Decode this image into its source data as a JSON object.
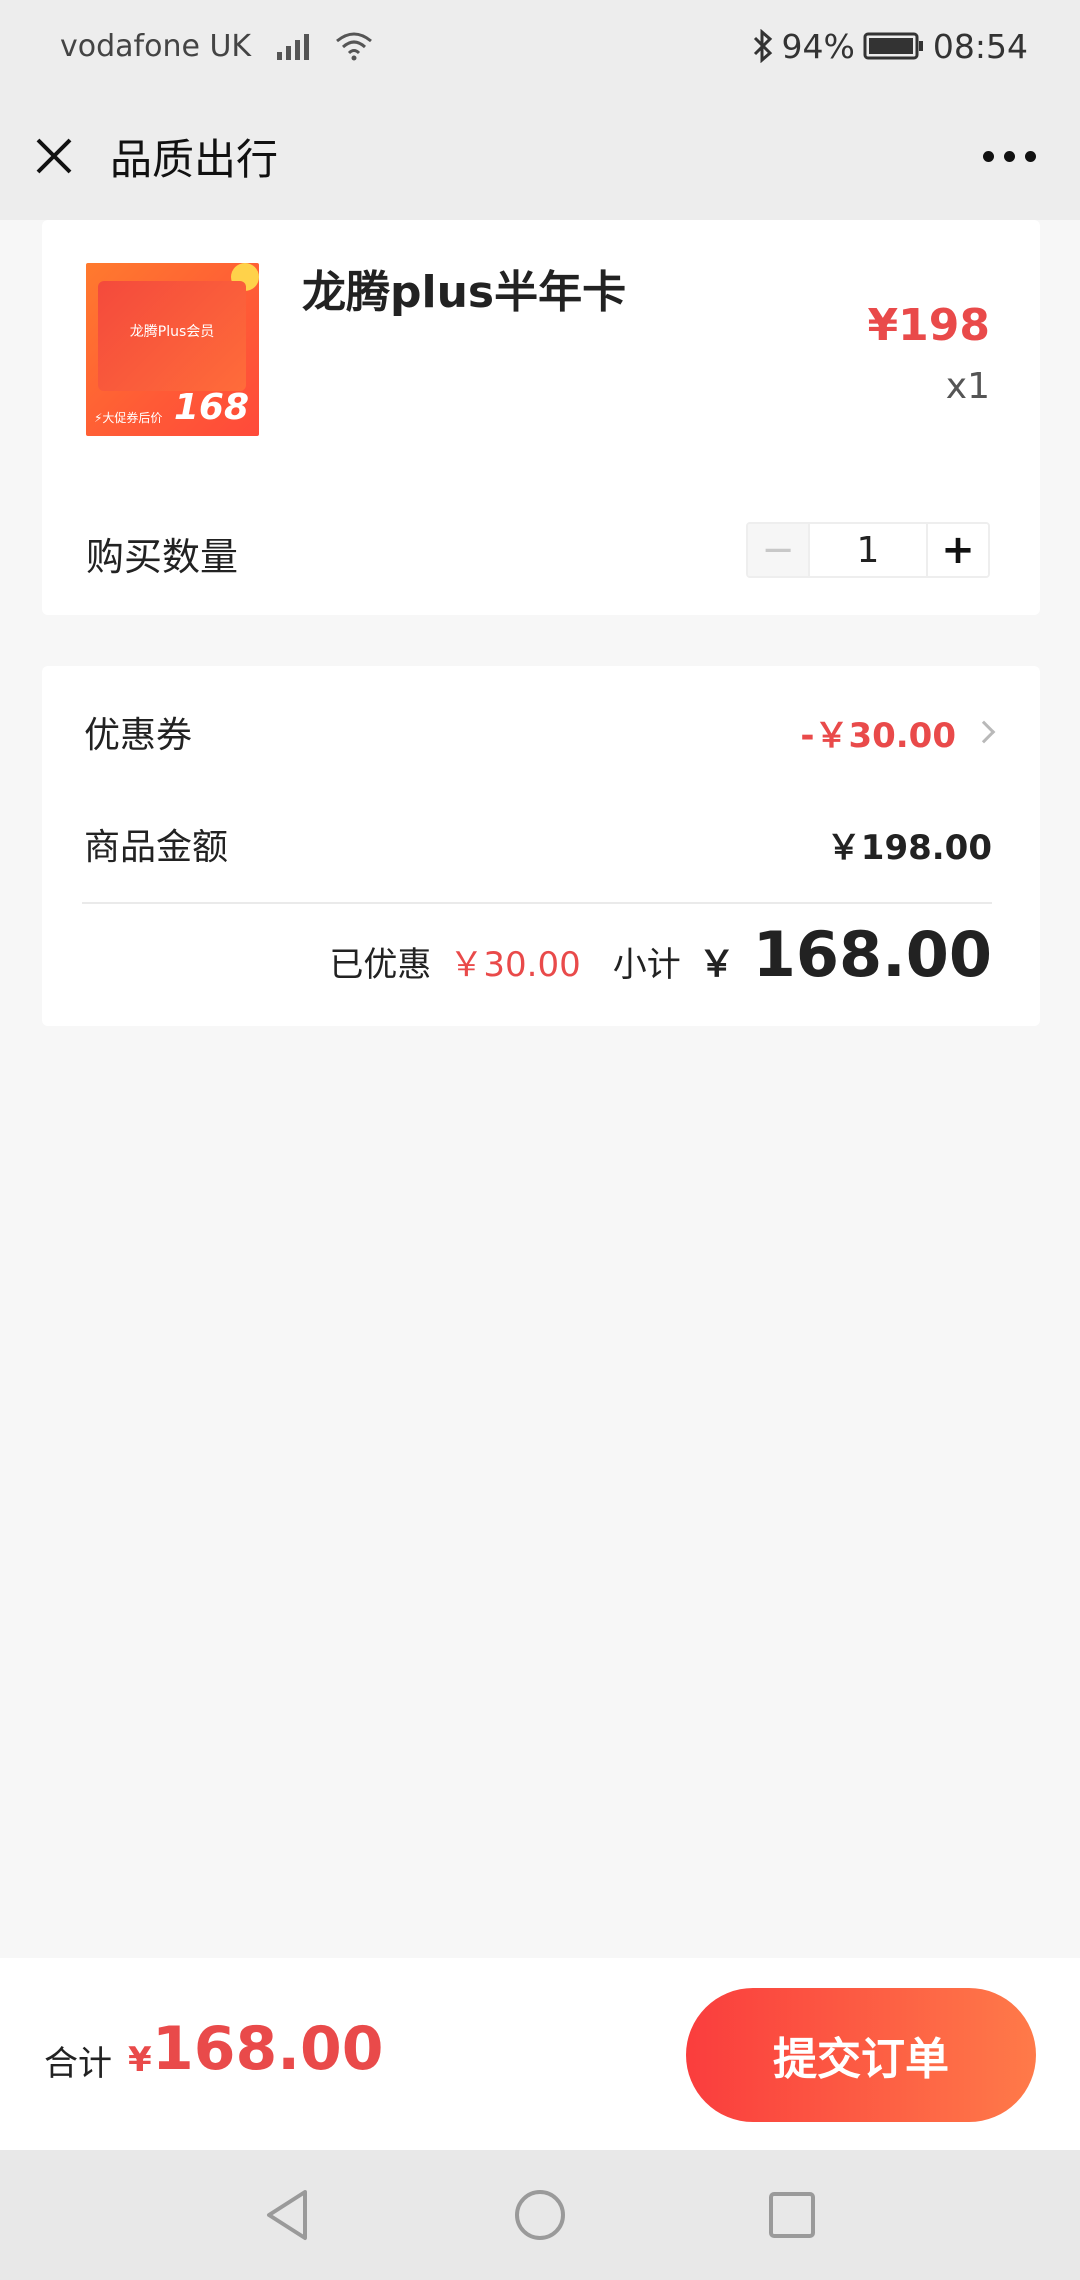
{
  "status_bar": {
    "carrier": "vodafone UK",
    "battery": "94%",
    "time": "08:54",
    "icons": [
      "signal-icon",
      "wifi-icon",
      "bluetooth-icon",
      "battery-icon"
    ]
  },
  "nav": {
    "title": "品质出行",
    "close_icon": "close-icon",
    "more_icon": "more-icon"
  },
  "product": {
    "name": "龙腾plus半年卡",
    "price": "¥198",
    "quantity_text": "x1",
    "thumbnail": {
      "title": "龙腾Plus会员",
      "price": "168",
      "promo": "⚡大促券后价"
    }
  },
  "purchase": {
    "label": "购买数量",
    "value": "1",
    "minus": "−",
    "plus": "+"
  },
  "summary": {
    "coupon_label": "优惠券",
    "coupon_value": "-￥30.00",
    "amount_label": "商品金额",
    "amount_value": "￥198.00",
    "discount_label": "已优惠",
    "discount_value": "￥30.00",
    "subtotal_label": "小计",
    "subtotal_currency": "￥",
    "subtotal_value": "168.00"
  },
  "bottom_bar": {
    "total_label": "合计",
    "total_currency": "¥",
    "total_value": "168.00",
    "submit_label": "提交订单"
  },
  "colors": {
    "accent": "#e94a4a",
    "button_start": "#fa3d3d",
    "button_end": "#ff7a49",
    "background": "#f7f7f7",
    "bar": "#ededed"
  }
}
